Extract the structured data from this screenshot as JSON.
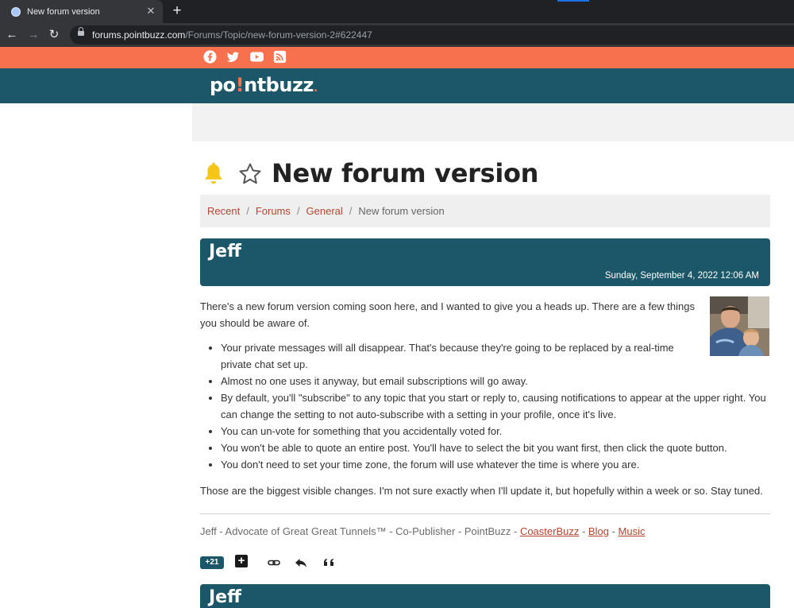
{
  "browser": {
    "tab_title": "New forum version",
    "url_host": "forums.pointbuzz.com",
    "url_path": "/Forums/Topic/new-forum-version-2#622447"
  },
  "site": {
    "logo_left": "po",
    "logo_mark": "!",
    "logo_right": "ntbuzz",
    "logo_dot": ".",
    "social_icons": [
      "facebook-icon",
      "twitter-icon",
      "youtube-icon",
      "rss-icon"
    ],
    "colors": {
      "accent": "#f7714f",
      "brand": "#1b5768",
      "link": "#b5452f",
      "bell": "#f5c518"
    }
  },
  "topic": {
    "title": "New forum version",
    "breadcrumbs": [
      "Recent",
      "Forums",
      "General"
    ],
    "current": "New forum version"
  },
  "post": {
    "author": "Jeff",
    "timestamp": "Sunday, September 4, 2022 12:06 AM",
    "intro": "There's a new forum version coming soon here, and I wanted to give you a heads up. There are a few things you should be aware of.",
    "bullets": [
      "Your private messages will all disappear. That's because they're going to be replaced by a real-time private chat set up.",
      "Almost no one uses it anyway, but email subscriptions will go away.",
      "By default, you'll \"subscribe\" to any topic that you start or reply to, causing notifications to appear at the upper right. You can change the setting to not auto-subscribe with a setting in your profile, once it's live.",
      "You can un-vote for something that you accidentally voted for.",
      "You won't be able to quote an entire post. You'll have to select the bit you want first, then click the quote button.",
      "You don't need to set your time zone, the forum will use whatever the time is where you are."
    ],
    "closing": "Those are the biggest visible changes. I'm not sure exactly when I'll update it, but hopefully within a week or so. Stay tuned.",
    "signature_text": "Jeff - Advocate of Great Great Tunnels™ - Co-Publisher - PointBuzz - ",
    "sig_link1": "CoasterBuzz",
    "sig_sep1": " - ",
    "sig_link2": "Blog",
    "sig_sep2": " - ",
    "sig_link3": "Music",
    "votes": "+21",
    "plus": "+"
  },
  "next_post": {
    "author": "Jeff"
  }
}
